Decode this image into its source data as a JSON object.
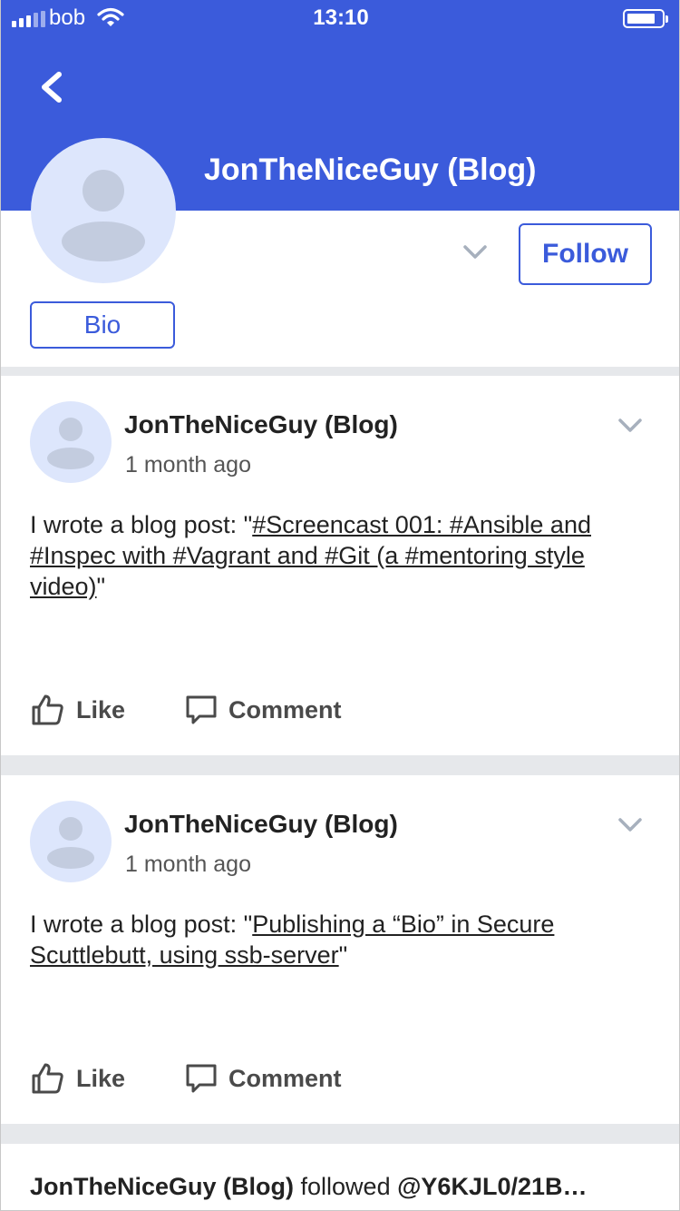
{
  "status_bar": {
    "carrier": "bob",
    "time": "13:10",
    "icons": [
      "signal-icon",
      "wifi-icon",
      "battery-icon"
    ]
  },
  "header": {
    "back_icon": "chevron-left-icon",
    "profile_name": "JonTheNiceGuy (Blog)",
    "menu_icon": "chevron-down-icon",
    "follow_label": "Follow",
    "bio_label": "Bio"
  },
  "colors": {
    "brand": "#3b5bdb",
    "avatar_bg": "#dde6fc",
    "avatar_fg": "#c3ccdf",
    "divider": "#e6e8eb"
  },
  "posts": [
    {
      "author": "JonTheNiceGuy (Blog)",
      "time": "1 month ago",
      "body_prefix": "I wrote a blog post: \"",
      "link_text": "#Screencast 001: #Ansible and #Inspec with #Vagrant and #Git (a #mentoring style video)",
      "body_suffix": "\"",
      "like_label": "Like",
      "comment_label": "Comment"
    },
    {
      "author": "JonTheNiceGuy (Blog)",
      "time": "1 month ago",
      "body_prefix": "I wrote a blog post: \"",
      "link_text": "Publishing a “Bio” in Secure Scuttlebutt, using ssb-server",
      "body_suffix": "\"",
      "like_label": "Like",
      "comment_label": "Comment"
    }
  ],
  "activity": {
    "actor": "JonTheNiceGuy (Blog)",
    "verb": " followed ",
    "target": "@Y6KJL0/21B…"
  }
}
